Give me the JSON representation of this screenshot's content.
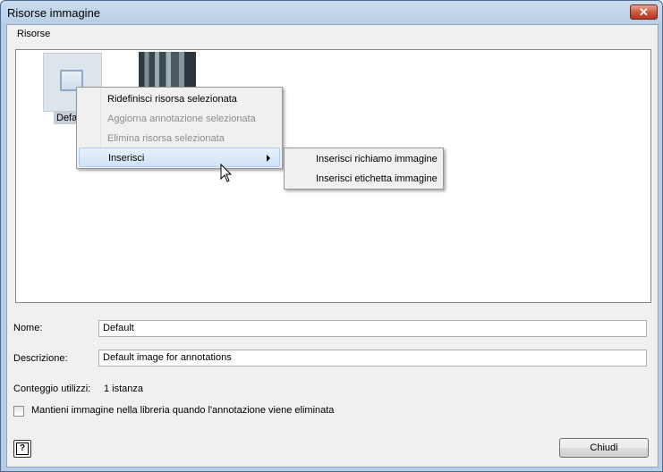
{
  "window": {
    "title": "Risorse immagine"
  },
  "menubar": {
    "risorse": "Risorse"
  },
  "resources": {
    "default_label": "Defa"
  },
  "context_menu": {
    "items": [
      {
        "label": "Ridefinisci risorsa selezionata",
        "enabled": true
      },
      {
        "label": "Aggiorna annotazione selezionata",
        "enabled": false
      },
      {
        "label": "Elimina risorsa selezionata",
        "enabled": false
      },
      {
        "label": "Inserisci",
        "enabled": true,
        "has_submenu": true,
        "highlighted": true
      }
    ]
  },
  "submenu": {
    "items": [
      {
        "label": "Inserisci richiamo immagine"
      },
      {
        "label": "Inserisci etichetta immagine"
      }
    ]
  },
  "form": {
    "name_label": "Nome:",
    "name_value": "Default",
    "description_label": "Descrizione:",
    "description_value": "Default image for annotations",
    "usage_label": "Conteggio utilizzi:",
    "usage_value": "1 istanza",
    "keep_checkbox_label": "Mantieni immagine nella libreria quando l'annotazione viene eliminata",
    "keep_checked": false
  },
  "buttons": {
    "help": "?",
    "close": "Chiudi"
  },
  "colors": {
    "highlight": "#cfe3f8",
    "disabled_text": "#8d8d8d",
    "close_button": "#cf5a3f"
  }
}
